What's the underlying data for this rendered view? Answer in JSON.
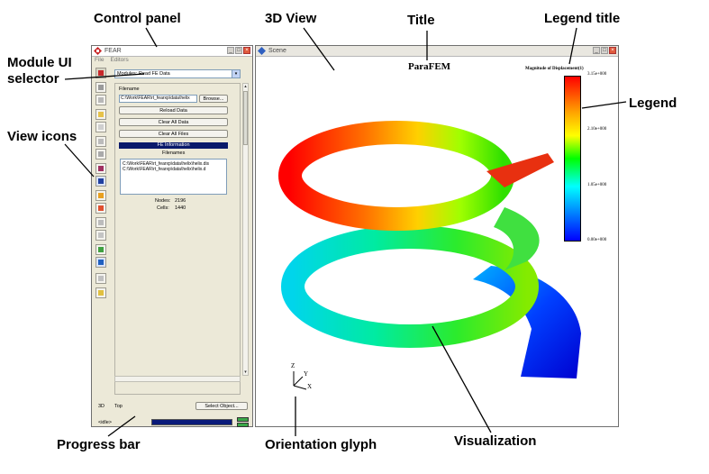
{
  "annotations": {
    "control_panel": "Control panel",
    "view_3d": "3D View",
    "title": "Title",
    "legend_title": "Legend title",
    "module_ui_selector_1": "Module UI",
    "module_ui_selector_2": "selector",
    "legend": "Legend",
    "view_icons": "View icons",
    "progress_bar": "Progress bar",
    "orientation_glyph": "Orientation glyph",
    "visualization": "Visualization"
  },
  "control_window": {
    "title": "FEAR",
    "menu": [
      "File",
      "Editors"
    ],
    "module_label": "Modules",
    "module_selected": "Read FE Data",
    "filename_label": "Filename",
    "filename_value": "C:\\Work\\FEAR\\rt_fearxp\\data\\helix",
    "browse_button": "Browse...",
    "reload_button": "Reload Data",
    "clear_data_button": "Clear All Data",
    "clear_files_button": "Clear All Files",
    "fe_info_header": "FE Information",
    "filenames_header": "Filenames",
    "file_list": [
      "C:\\Work\\FEAR\\rt_fearxp\\data\\helix\\helix.dis",
      "C:\\Work\\FEAR\\rt_fearxp\\data\\helix\\helix.d"
    ],
    "nodes_label": "Nodes:",
    "nodes_value": "2196",
    "cells_label": "Cells:",
    "cells_value": "1440",
    "mode_3d": "3D",
    "view_name": "Top",
    "select_object_button": "Select Object...",
    "status_text": "<idle>",
    "progress": 1.0
  },
  "scene_window": {
    "title": "Scene",
    "plot_title": "ParaFEM",
    "legend_title": "Magnitude of Displacement(1)",
    "legend_ticks": [
      "3.15e+000",
      "2.10e+000",
      "1.05e+000",
      "0.00e+000"
    ],
    "axes": {
      "x": "X",
      "y": "Y",
      "z": "Z"
    }
  },
  "colors": {
    "accent": "#0a1a6b",
    "window_bg": "#ece9d8",
    "close_button": "#e05a3c"
  },
  "icons": [
    "fear-logo-icon",
    "minimize-icon",
    "maximize-icon",
    "close-icon",
    "dropdown-arrow-icon"
  ]
}
